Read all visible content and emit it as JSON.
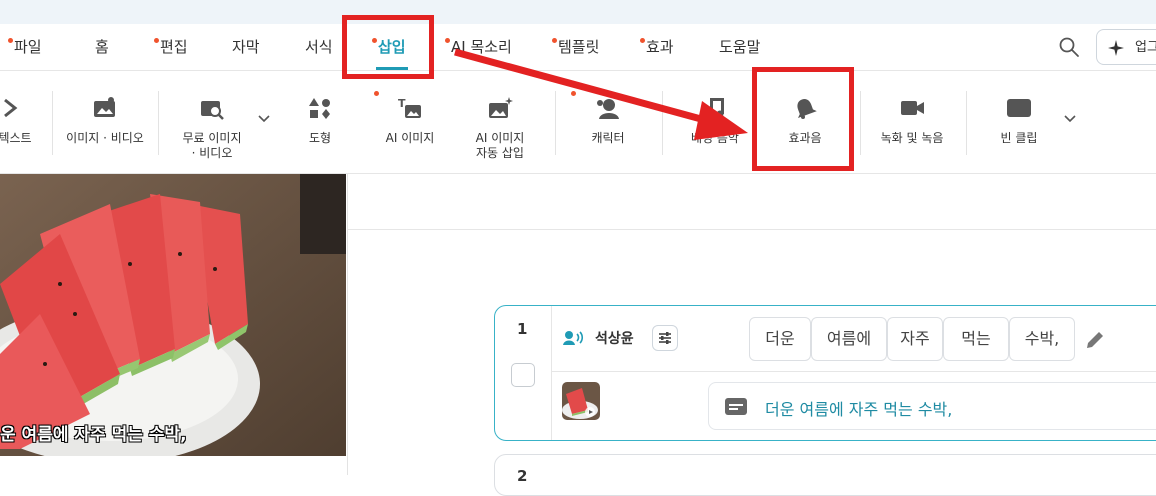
{
  "menu": {
    "tabs": [
      {
        "label": "파일",
        "dot": true
      },
      {
        "label": "홈",
        "dot": false
      },
      {
        "label": "편집",
        "dot": true
      },
      {
        "label": "자막",
        "dot": false
      },
      {
        "label": "서식",
        "dot": false
      },
      {
        "label": "삽입",
        "dot": true,
        "active": true
      },
      {
        "label": "AI 목소리",
        "dot": true
      },
      {
        "label": "템플릿",
        "dot": true
      },
      {
        "label": "효과",
        "dot": true
      },
      {
        "label": "도움말",
        "dot": false
      }
    ],
    "upgrade_label": "업그"
  },
  "ribbon": {
    "items": [
      {
        "label": "텍스트",
        "icon": "text-icon"
      },
      {
        "label": "이미지 · 비디오",
        "icon": "image-video-icon"
      },
      {
        "label": "무료 이미지\n· 비디오",
        "icon": "free-image-search-icon"
      },
      {
        "label": "도형",
        "icon": "shapes-icon"
      },
      {
        "label": "AI 이미지",
        "icon": "ai-image-icon"
      },
      {
        "label": "AI 이미지\n자동 삽입",
        "icon": "ai-image-auto-icon"
      },
      {
        "label": "캐릭터",
        "icon": "character-icon"
      },
      {
        "label": "배경 음악",
        "icon": "music-icon"
      },
      {
        "label": "효과음",
        "icon": "bell-icon"
      },
      {
        "label": "녹화 및 녹음",
        "icon": "video-camera-icon"
      },
      {
        "label": "빈 클립",
        "icon": "blank-clip-icon"
      }
    ]
  },
  "preview": {
    "caption": "운 여름에 자주 먹는 수박,"
  },
  "clip1": {
    "number": "1",
    "speaker": "석상윤",
    "words": [
      "더운",
      "여름에",
      "자주",
      "먹는",
      "수박,"
    ],
    "subtitle": "더운 여름에 자주 먹는 수박,"
  },
  "clip2": {
    "number": "2"
  },
  "colors": {
    "accent": "#1f9bb5",
    "annotation": "#e32222",
    "notification_dot": "#f0532d"
  }
}
